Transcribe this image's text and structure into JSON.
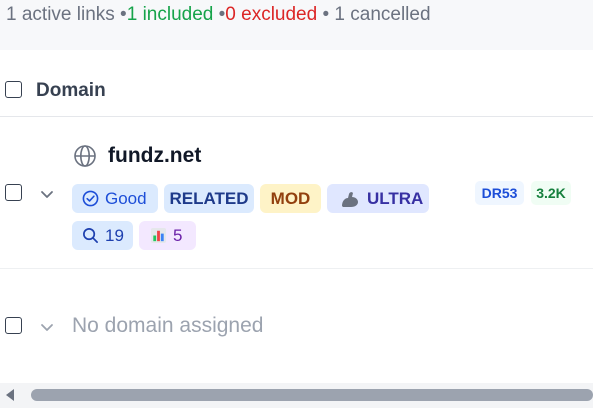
{
  "summary": {
    "active": "1 active links",
    "sep1": " •",
    "included": "1 included",
    "sep2": " •",
    "excluded": "0 excluded",
    "sep3": " • ",
    "cancelled": "1 cancelled"
  },
  "table": {
    "domain_header": "Domain"
  },
  "rows": [
    {
      "domain": "fundz.net",
      "icon": "globe-icon",
      "badges": {
        "quality": "Good",
        "relation": "RELATED",
        "moderation": "MOD",
        "tier": "ULTRA",
        "search": "19",
        "chart": "5"
      },
      "metrics": {
        "dr": "DR53",
        "traffic": "3.2K"
      }
    },
    {
      "domain_placeholder": "No domain assigned"
    }
  ],
  "colors": {
    "included": "#16a34a",
    "excluded": "#dc2626",
    "accent": "#1d4ed8"
  }
}
